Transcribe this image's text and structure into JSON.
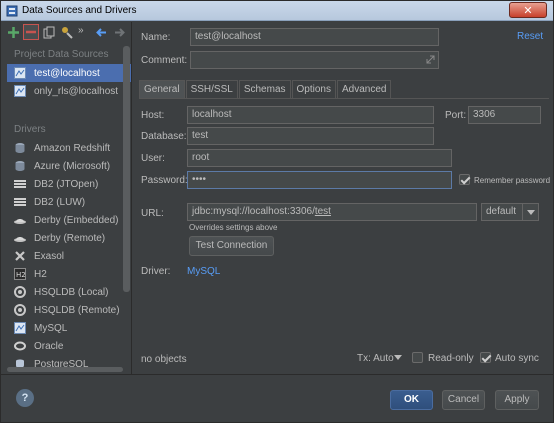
{
  "window": {
    "title": "Data Sources and Drivers"
  },
  "sidebar": {
    "project_section": "Project Data Sources",
    "data_sources": [
      {
        "label": "test@localhost",
        "selected": true
      },
      {
        "label": "only_rls@localhost",
        "selected": false
      }
    ],
    "drivers_section": "Drivers",
    "drivers": [
      {
        "label": "Amazon Redshift"
      },
      {
        "label": "Azure (Microsoft)"
      },
      {
        "label": "DB2 (JTOpen)"
      },
      {
        "label": "DB2 (LUW)"
      },
      {
        "label": "Derby (Embedded)"
      },
      {
        "label": "Derby (Remote)"
      },
      {
        "label": "Exasol"
      },
      {
        "label": "H2"
      },
      {
        "label": "HSQLDB (Local)"
      },
      {
        "label": "HSQLDB (Remote)"
      },
      {
        "label": "MySQL"
      },
      {
        "label": "Oracle"
      },
      {
        "label": "PostgreSQL"
      }
    ]
  },
  "form": {
    "name_label": "Name:",
    "name_value": "test@localhost",
    "comment_label": "Comment:",
    "comment_value": "",
    "reset": "Reset",
    "tabs": [
      "General",
      "SSH/SSL",
      "Schemas",
      "Options",
      "Advanced"
    ],
    "active_tab": "General",
    "host_label": "Host:",
    "host_value": "localhost",
    "port_label": "Port:",
    "port_value": "3306",
    "database_label": "Database:",
    "database_value": "test",
    "user_label": "User:",
    "user_value": "root",
    "password_label": "Password:",
    "password_value": "••••",
    "remember_password": "Remember password",
    "remember_checked": true,
    "url_label": "URL:",
    "url_prefix": "jdbc:mysql://localhost:3306/",
    "url_db": "test",
    "url_mode": "default",
    "url_hint": "Overrides settings above",
    "test_connection": "Test Connection",
    "driver_label": "Driver:",
    "driver_value": "MySQL"
  },
  "status": {
    "objects": "no objects",
    "tx": "Tx: Auto",
    "read_only": "Read-only",
    "read_only_checked": false,
    "auto_sync": "Auto sync",
    "auto_sync_checked": true
  },
  "footer": {
    "help": "?",
    "ok": "OK",
    "cancel": "Cancel",
    "apply": "Apply"
  },
  "colors": {
    "background": "#3c3f41",
    "selection": "#4b6eaf",
    "link": "#589df6",
    "field": "#45494a"
  }
}
